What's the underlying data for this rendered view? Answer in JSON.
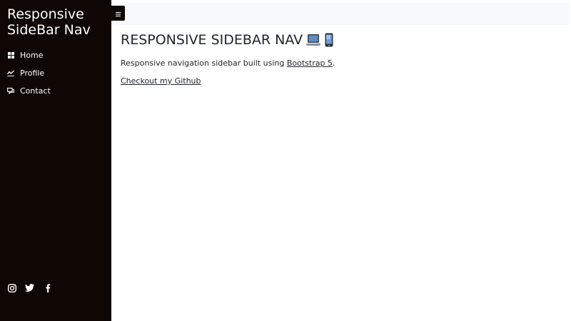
{
  "sidebar": {
    "brand": "Responsive SideBar Nav",
    "items": [
      {
        "label": "Home",
        "icon": "grid-icon"
      },
      {
        "label": "Profile",
        "icon": "chart-icon"
      },
      {
        "label": "Contact",
        "icon": "chat-icon"
      }
    ],
    "social": [
      "instagram-icon",
      "twitter-icon",
      "facebook-icon"
    ]
  },
  "topbar": {
    "toggle_icon": "menu-icon"
  },
  "main": {
    "title": "RESPONSIVE SIDEBAR NAV",
    "intro_prefix": "Responsive navigation sidebar built using ",
    "intro_link": "Bootstrap 5",
    "intro_suffix": ".",
    "github_link": "Checkout my Github"
  },
  "colors": {
    "sidebar_bg": "#0e0704",
    "topbar_bg": "#f8f9fa",
    "text": "#212529"
  }
}
